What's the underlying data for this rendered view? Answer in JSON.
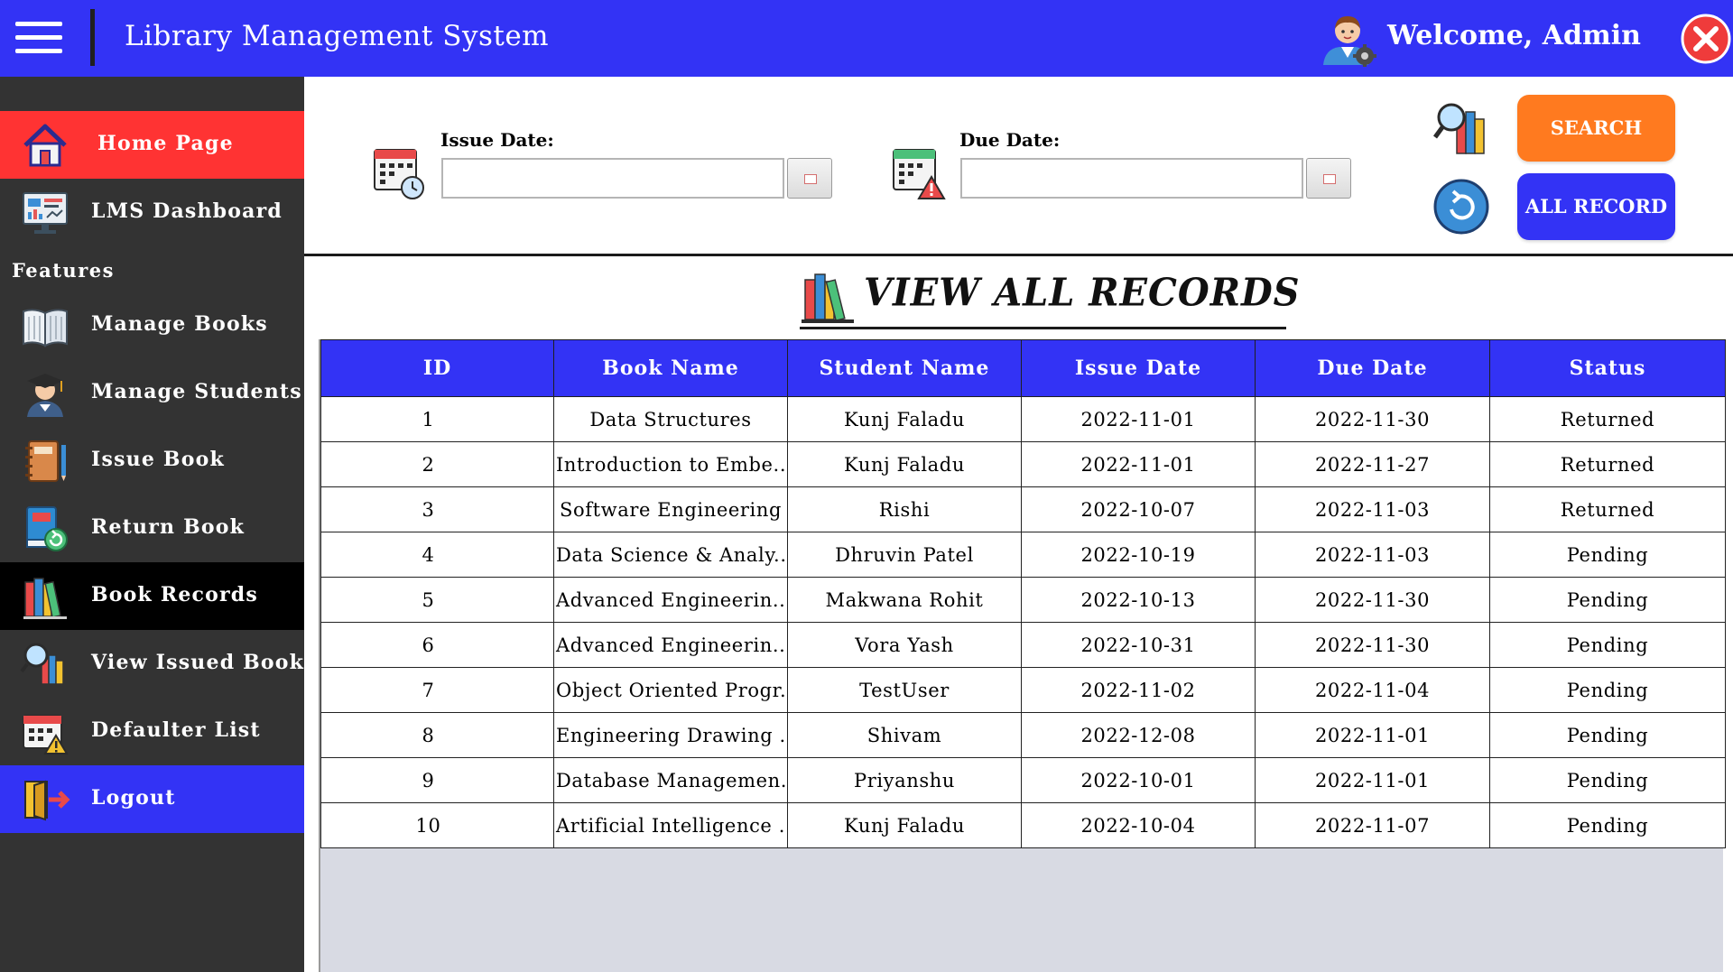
{
  "header": {
    "title": "Library Management System",
    "welcome": "Welcome, Admin",
    "accent_color": "#3333f5"
  },
  "sidebar": {
    "features_label": "Features",
    "items": [
      {
        "label": "Home Page",
        "icon": "home-icon"
      },
      {
        "label": "LMS Dashboard",
        "icon": "dashboard-icon"
      },
      {
        "label": "Manage Books",
        "icon": "book-icon"
      },
      {
        "label": "Manage Students",
        "icon": "student-icon"
      },
      {
        "label": "Issue Book",
        "icon": "notebook-icon"
      },
      {
        "label": "Return Book",
        "icon": "return-book-icon"
      },
      {
        "label": "Book Records",
        "icon": "books-icon"
      },
      {
        "label": "View Issued Books",
        "icon": "search-books-icon"
      },
      {
        "label": "Defaulter List",
        "icon": "calendar-warning-icon"
      },
      {
        "label": "Logout",
        "icon": "logout-icon"
      }
    ]
  },
  "filters": {
    "issue_date_label": "Issue Date:",
    "issue_date_value": "",
    "due_date_label": "Due Date:",
    "due_date_value": "",
    "search_label": "SEARCH",
    "all_record_label": "ALL RECORD"
  },
  "records": {
    "title": "VIEW ALL RECORDS",
    "columns": [
      "ID",
      "Book Name",
      "Student Name",
      "Issue Date",
      "Due Date",
      "Status"
    ],
    "rows": [
      [
        "1",
        "Data Structures",
        "Kunj Faladu",
        "2022-11-01",
        "2022-11-30",
        "Returned"
      ],
      [
        "2",
        "Introduction to Embe...",
        "Kunj Faladu",
        "2022-11-01",
        "2022-11-27",
        "Returned"
      ],
      [
        "3",
        "Software Engineering",
        "Rishi",
        "2022-10-07",
        "2022-11-03",
        "Returned"
      ],
      [
        "4",
        "Data Science & Analy...",
        "Dhruvin Patel",
        "2022-10-19",
        "2022-11-03",
        "Pending"
      ],
      [
        "5",
        "Advanced Engineerin...",
        "Makwana Rohit",
        "2022-10-13",
        "2022-11-30",
        "Pending"
      ],
      [
        "6",
        "Advanced Engineerin...",
        "Vora Yash",
        "2022-10-31",
        "2022-11-30",
        "Pending"
      ],
      [
        "7",
        "Object Oriented Progr...",
        "TestUser",
        "2022-11-02",
        "2022-11-04",
        "Pending"
      ],
      [
        "8",
        "Engineering Drawing ...",
        "Shivam",
        "2022-12-08",
        "2022-11-01",
        "Pending"
      ],
      [
        "9",
        "Database Managemen...",
        "Priyanshu",
        "2022-10-01",
        "2022-11-01",
        "Pending"
      ],
      [
        "10",
        "Artificial Intelligence ...",
        "Kunj Faladu",
        "2022-10-04",
        "2022-11-07",
        "Pending"
      ]
    ]
  }
}
